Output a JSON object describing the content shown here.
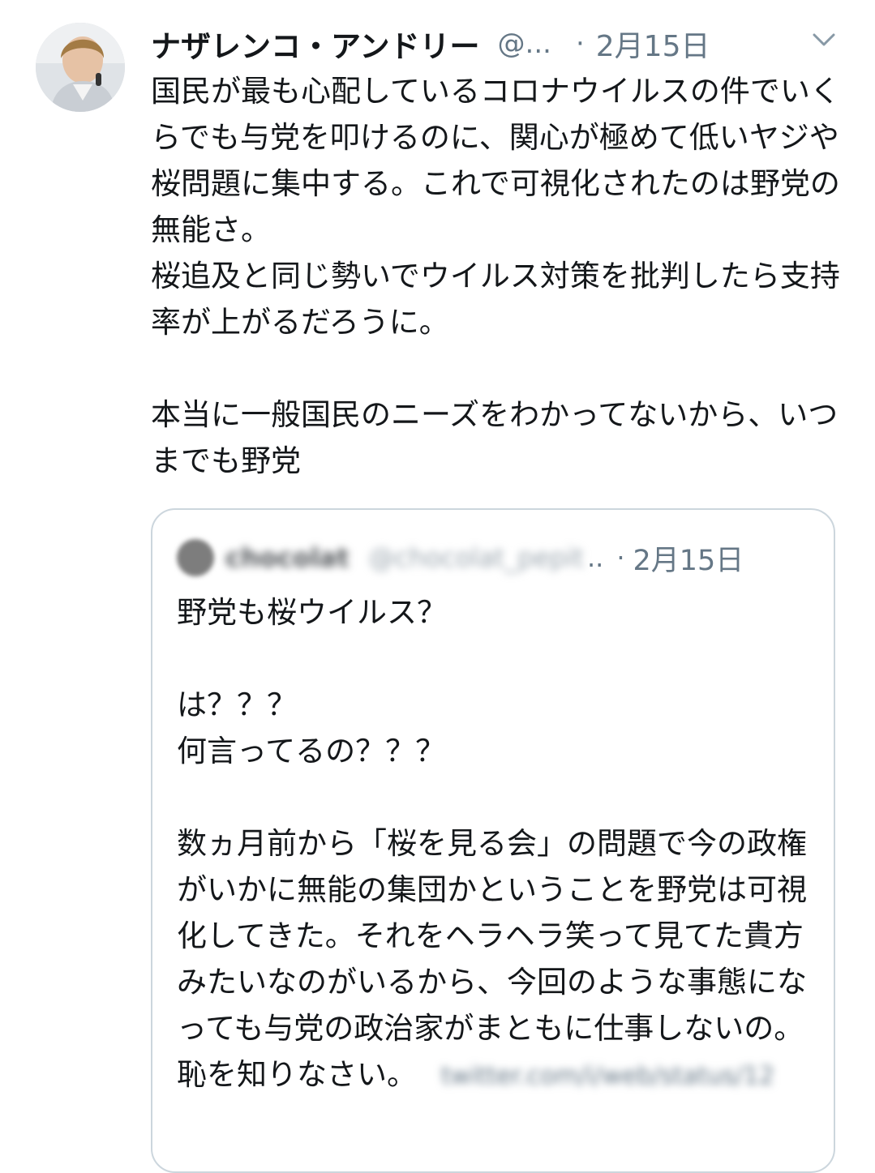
{
  "tweet": {
    "author_name": "ナザレンコ・アンドリー",
    "author_handle": "@...",
    "separator": "·",
    "date": "2月15日",
    "text": "国民が最も心配しているコロナウイルスの件でいくらでも与党を叩けるのに、関心が極めて低いヤジや桜問題に集中する。これで可視化されたのは野党の無能さ。\n桜追及と同じ勢いでウイルス対策を批判したら支持率が上がるだろうに。\n\n本当に一般国民のニーズをわかってないから、いつまでも野党",
    "menu_icon": "chevron-down-icon"
  },
  "quoted_tweet": {
    "author_name": "chocolat",
    "author_handle": "@chocolat_pepit",
    "truncation": "..",
    "separator": "·",
    "date": "2月15日",
    "text": "野党も桜ウイルス？\n\nは？？？\n何言ってるの？？？\n\n数ヵ月前から「桜を見る会」の問題で今の政権がいかに無能の集団かということを野党は可視化してきた。それをヘラヘラ笑って見てた貴方みたいなのがいるから、今回のような事態になっても与党の政治家がまともに仕事しないの。恥を知りなさい。",
    "link_text": "twitter.com/i/web/status/12"
  },
  "colors": {
    "text": "#14171a",
    "secondary": "#657786",
    "border": "#ccd6dd"
  }
}
